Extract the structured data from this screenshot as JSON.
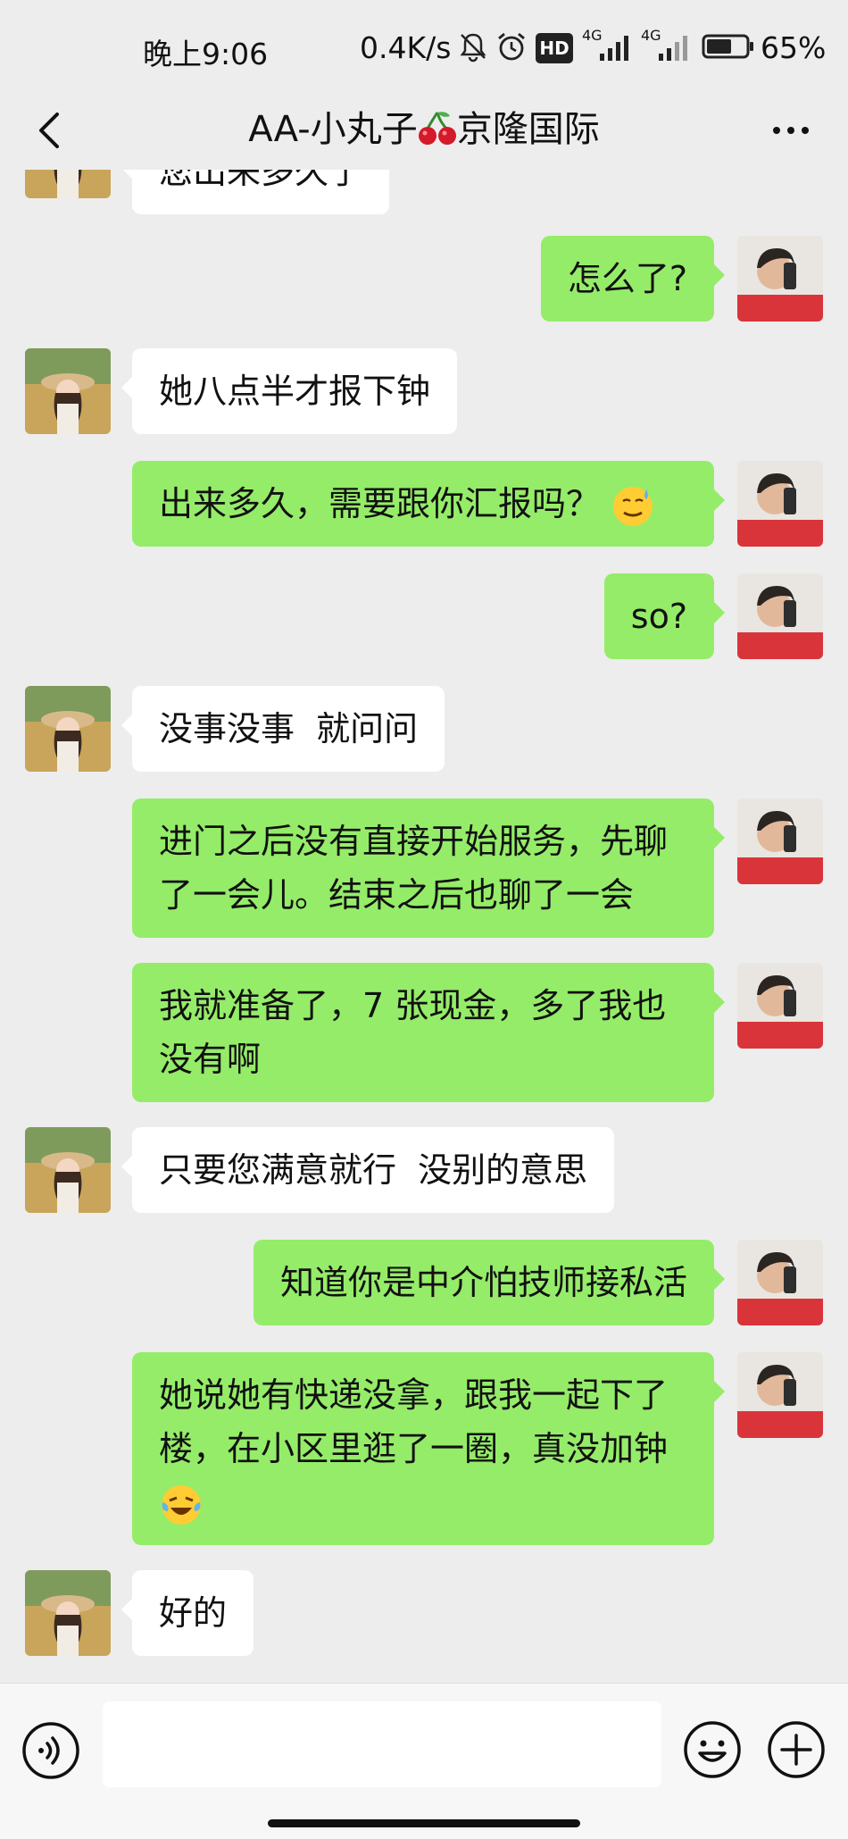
{
  "status_bar": {
    "time": "晚上9:06",
    "network_speed": "0.4K/s",
    "hd_badge": "HD",
    "signal1_label": "4G",
    "signal2_label": "4G",
    "battery_percent": "65%",
    "battery_level": 0.65
  },
  "nav": {
    "title_prefix": "AA-小丸子",
    "title_suffix": "京隆国际",
    "title_icon": "cherry-icon"
  },
  "messages": [
    {
      "side": "left",
      "text": "您出来多久了",
      "clipped": true
    },
    {
      "side": "right",
      "text": "怎么了?"
    },
    {
      "side": "left",
      "text": "她八点半才报下钟"
    },
    {
      "side": "right",
      "text": "出来多久，需要跟你汇报吗？",
      "emoji": "sweat-smile-icon"
    },
    {
      "side": "right",
      "text": "so?"
    },
    {
      "side": "left",
      "text": "没事没事  就问问"
    },
    {
      "side": "right",
      "text": "进门之后没有直接开始服务，先聊了一会儿。结束之后也聊了一会"
    },
    {
      "side": "right",
      "text": "我就准备了，7 张现金，多了我也没有啊"
    },
    {
      "side": "left",
      "text": "只要您满意就行  没别的意思"
    },
    {
      "side": "right",
      "text": "知道你是中介怕技师接私活"
    },
    {
      "side": "right",
      "text": "她说她有快递没拿，跟我一起下了楼，在小区里逛了一圈，真没加钟",
      "emoji": "laugh-cry-icon"
    },
    {
      "side": "left",
      "text": "好的"
    }
  ],
  "input_bar": {
    "placeholder": ""
  },
  "colors": {
    "background": "#ededed",
    "outgoing_bubble": "#95ec69",
    "incoming_bubble": "#ffffff"
  }
}
